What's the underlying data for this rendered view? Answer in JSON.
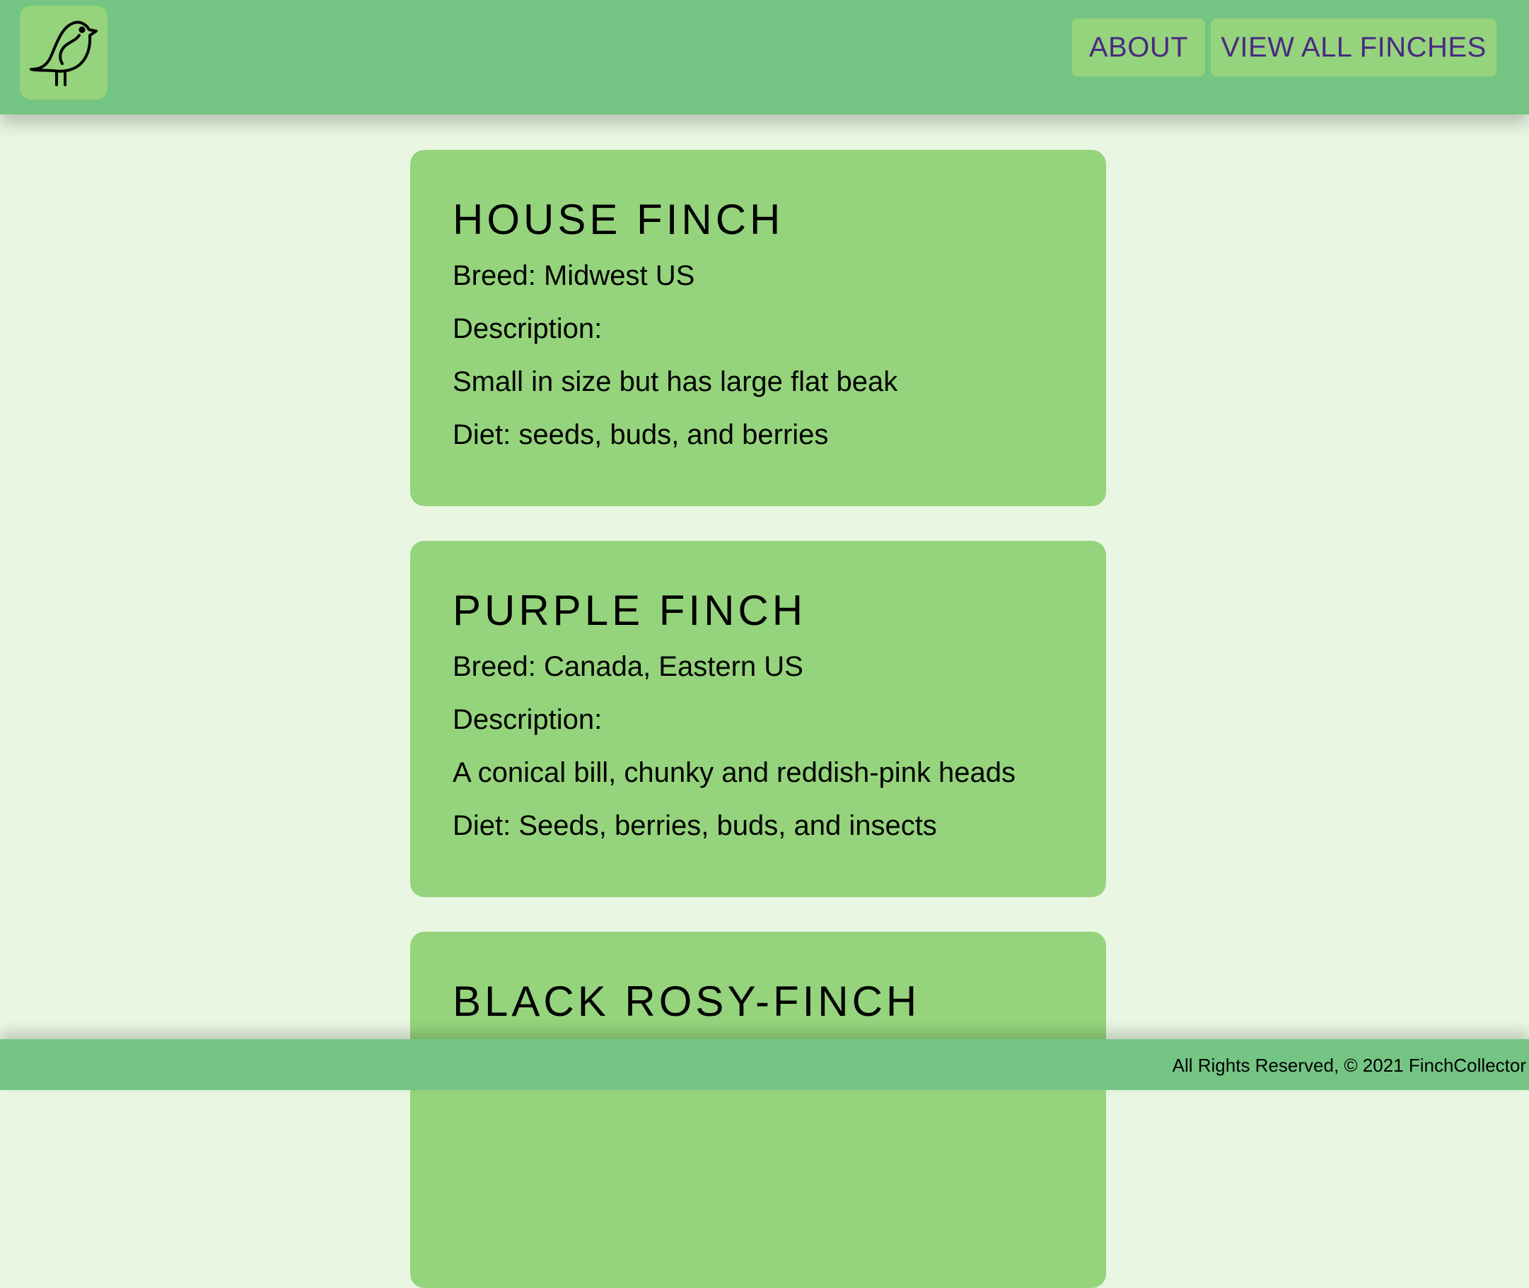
{
  "header": {
    "logo_icon": "bird-icon",
    "nav": {
      "about": "ABOUT",
      "view_all": "VIEW ALL FINCHES"
    }
  },
  "finches": [
    {
      "name": "HOUSE FINCH",
      "breed": "Breed: Midwest US",
      "description_label": "Description:",
      "description": "Small in size but has large flat beak",
      "diet": "Diet: seeds, buds, and berries"
    },
    {
      "name": "PURPLE FINCH",
      "breed": "Breed: Canada, Eastern US",
      "description_label": "Description:",
      "description": "A conical bill, chunky and reddish-pink heads",
      "diet": "Diet: Seeds, berries, buds, and insects"
    },
    {
      "name": "BLACK ROSY-FINCH"
    }
  ],
  "footer": {
    "text": "All Rights Reserved, © 2021 FinchCollector"
  },
  "colors": {
    "page_background": "#e9f7e2",
    "header_footer": "#74c584",
    "card": "#95d47c",
    "nav_text": "#4a2a82"
  }
}
